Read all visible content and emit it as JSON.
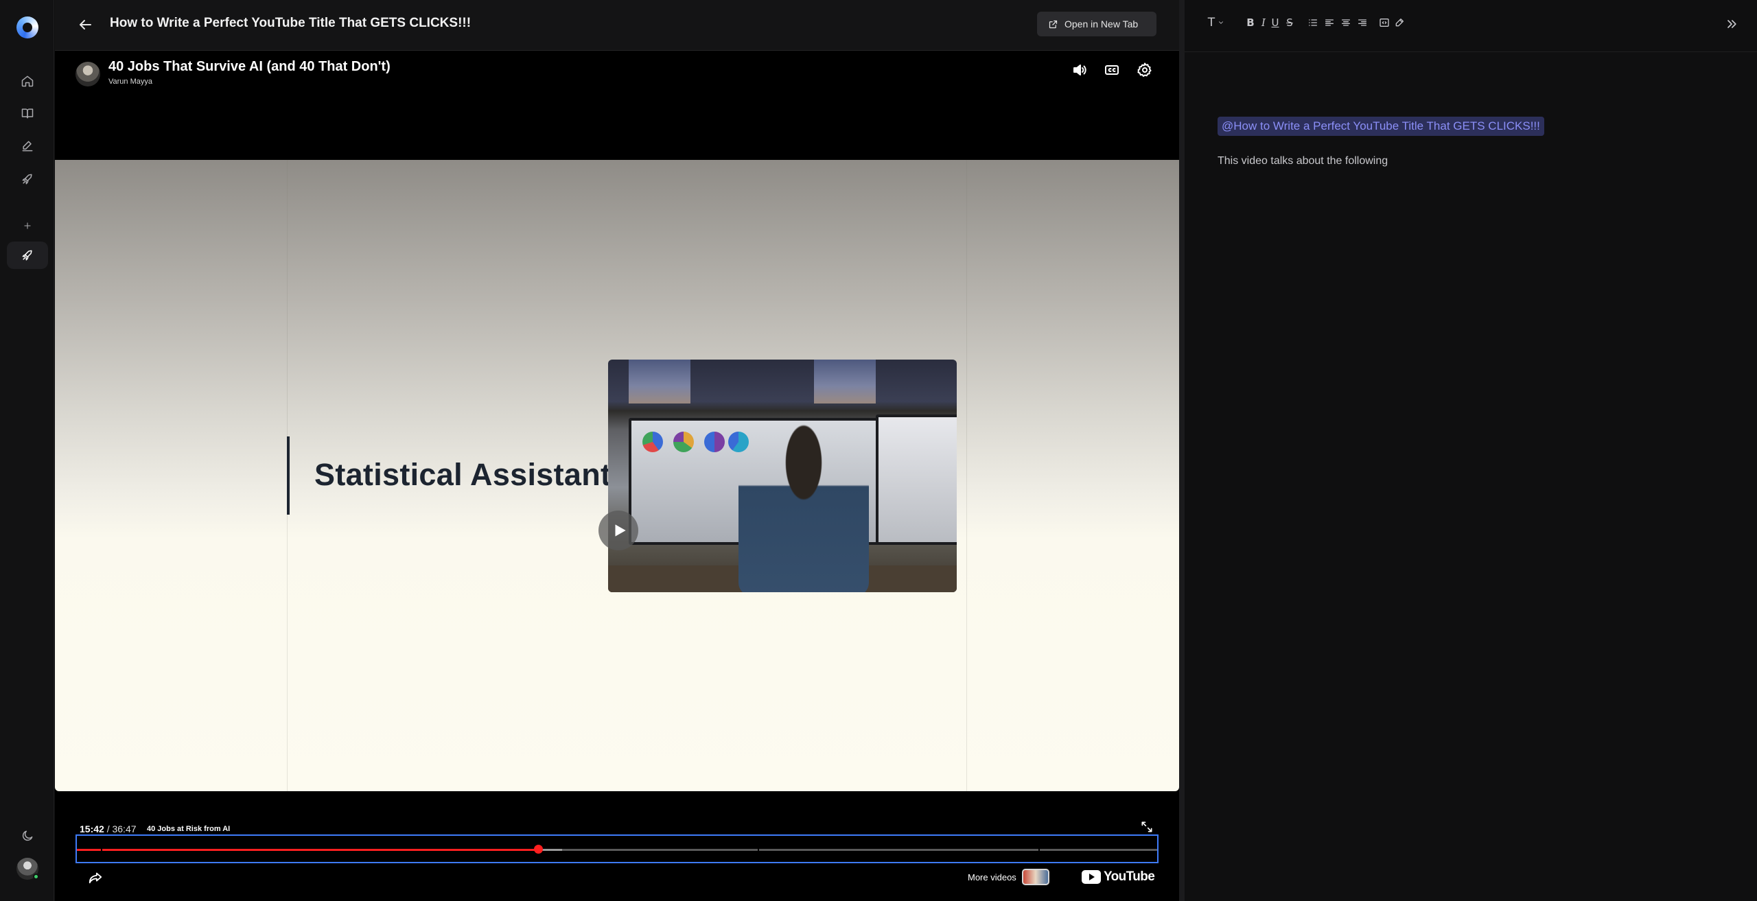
{
  "app": {
    "accent": "#3e7bfa",
    "nav_icons": [
      "home-icon",
      "book-icon",
      "edit-icon",
      "rocket-outline-icon",
      "plus-icon",
      "rocket-icon",
      "moon-icon"
    ]
  },
  "header": {
    "title": "How to Write a Perfect YouTube Title That GETS CLICKS!!!",
    "open_new_tab": "Open in New Tab"
  },
  "video": {
    "title": "40 Jobs That Survive AI (and 40 That Don't)",
    "channel": "Varun Mayya",
    "frame_text": "Statistical Assistants",
    "current_time": "15:42",
    "separator": " / ",
    "duration": "36:47",
    "chapter": "40 Jobs at Risk from AI",
    "progress_fraction": 0.427,
    "buffer_fraction": 0.449,
    "chapter_marks": [
      0.022,
      0.63,
      0.89
    ],
    "played_color": "#ff1f1f",
    "more_videos": "More videos",
    "brand": "YouTube"
  },
  "editor": {
    "toolbar_icons": [
      "text-style-icon",
      "bold-icon",
      "italic-icon",
      "underline-icon",
      "strikethrough-icon",
      "list-icon",
      "align-left-icon",
      "align-center-icon",
      "align-right-icon",
      "code-block-icon",
      "highlight-icon"
    ],
    "text_style_glyph": "T",
    "bold_glyph": "B",
    "italic_glyph": "I",
    "underline_glyph": "U",
    "strike_glyph": "S",
    "mention": "@How to Write a Perfect YouTube Title That GETS CLICKS!!!",
    "body": "This video talks about the following"
  }
}
